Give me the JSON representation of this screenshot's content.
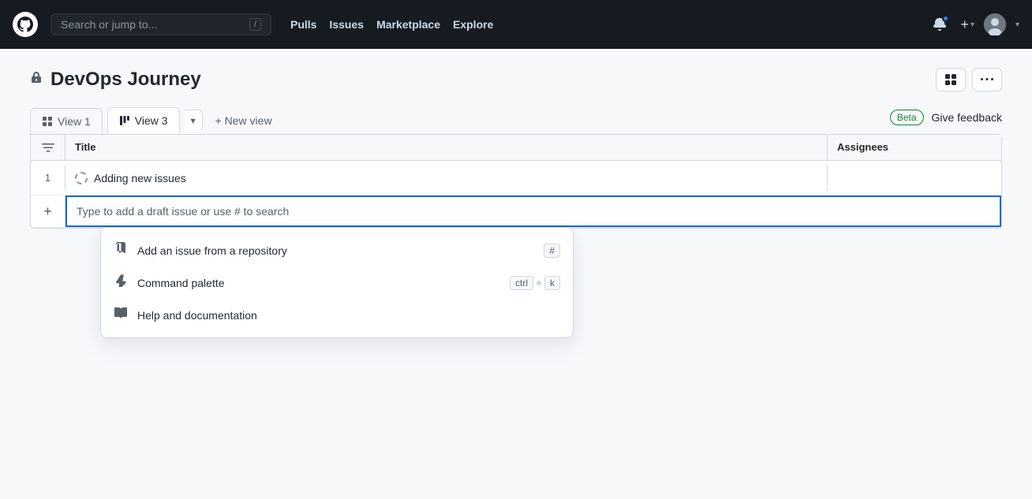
{
  "navbar": {
    "search_placeholder": "Search or jump to...",
    "search_kbd": "/",
    "links": [
      "Pulls",
      "Issues",
      "Marketplace",
      "Explore"
    ]
  },
  "project": {
    "title": "DevOps Journey"
  },
  "tabs": [
    {
      "label": "View 1",
      "icon": "table-icon",
      "active": false
    },
    {
      "label": "View 3",
      "icon": "board-icon",
      "active": true
    }
  ],
  "new_view_label": "+ New view",
  "beta_label": "Beta",
  "give_feedback_label": "Give feedback",
  "table": {
    "columns": [
      "Title",
      "Assignees"
    ],
    "rows": [
      {
        "num": "1",
        "title": "Adding new issues",
        "draft": true
      }
    ]
  },
  "add_input_placeholder": "Type to add a draft issue or use # to search",
  "dropdown": {
    "items": [
      {
        "id": "add-issue",
        "label": "Add an issue from a repository",
        "icon": "repo-icon",
        "shortcut": [
          "#"
        ]
      },
      {
        "id": "command-palette",
        "label": "Command palette",
        "icon": "zap-icon",
        "shortcut": [
          "ctrl",
          "·",
          "k"
        ]
      },
      {
        "id": "help",
        "label": "Help and documentation",
        "icon": "book-icon",
        "shortcut": []
      }
    ]
  }
}
